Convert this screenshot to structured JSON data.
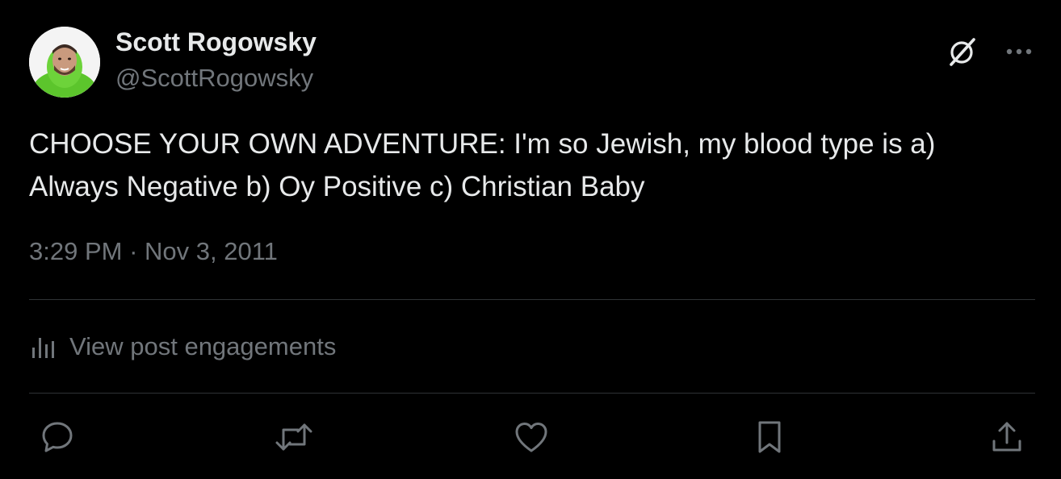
{
  "author": {
    "display_name": "Scott Rogowsky",
    "handle": "@ScottRogowsky",
    "avatar_icon": "profile-photo"
  },
  "tweet": {
    "text": "CHOOSE YOUR OWN ADVENTURE: I'm so Jewish, my blood type is a) Always Negative b) Oy Positive c) Christian Baby",
    "time": "3:29 PM",
    "separator": "·",
    "date": "Nov 3, 2011"
  },
  "engagements": {
    "label": "View post engagements",
    "icon": "bar-chart-icon"
  },
  "header_actions": {
    "grok_icon": "grok-icon",
    "more_icon": "more-dots-icon"
  },
  "actions": [
    {
      "name": "reply",
      "icon": "reply-icon"
    },
    {
      "name": "repost",
      "icon": "repost-icon"
    },
    {
      "name": "like",
      "icon": "heart-icon"
    },
    {
      "name": "bookmark",
      "icon": "bookmark-icon"
    },
    {
      "name": "share",
      "icon": "share-icon"
    }
  ],
  "colors": {
    "background": "#000000",
    "primary_text": "#e7e9ea",
    "secondary_text": "#71767b",
    "divider": "#2f3336"
  }
}
